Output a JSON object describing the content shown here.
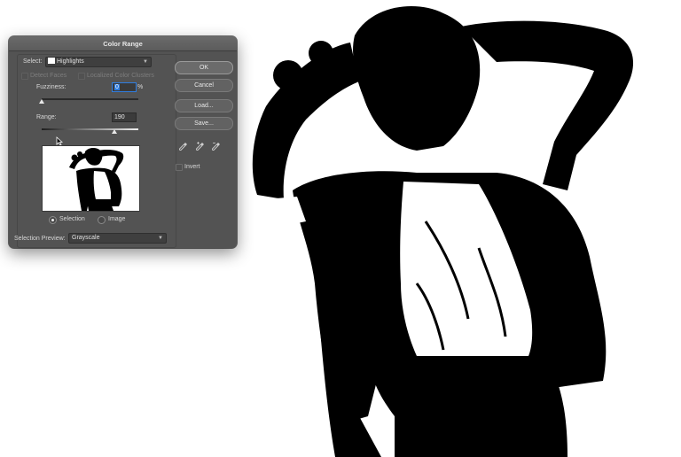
{
  "dialog": {
    "title": "Color Range",
    "select_label": "Select:",
    "select_value": "Highlights",
    "detect_faces_label": "Detect Faces",
    "localized_clusters_label": "Localized Color Clusters",
    "fuzziness_label": "Fuzziness:",
    "fuzziness_value": "0",
    "fuzziness_unit": "%",
    "fuzziness_slider": 0.0,
    "range_label": "Range:",
    "range_value": "190",
    "range_slider": 0.75,
    "preview_mode_selection": "Selection",
    "preview_mode_image": "Image",
    "selection_preview_label": "Selection Preview:",
    "selection_preview_value": "Grayscale",
    "buttons": {
      "ok": "OK",
      "cancel": "Cancel",
      "load": "Load...",
      "save": "Save..."
    },
    "invert_label": "Invert"
  },
  "icons": {
    "eyedroppers": [
      "eyedropper-icon",
      "eyedropper-plus-icon",
      "eyedropper-minus-icon"
    ],
    "chevron": "chevron-down-icon"
  },
  "colors": {
    "dialog_bg": "#535353",
    "focus_blue": "#2f7de0"
  }
}
